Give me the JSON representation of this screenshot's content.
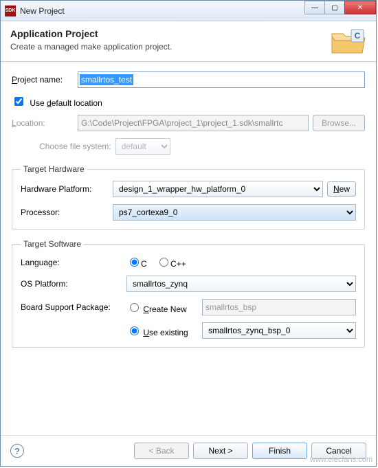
{
  "window": {
    "title": "New Project"
  },
  "header": {
    "title": "Application Project",
    "subtitle": "Create a managed make application project."
  },
  "project": {
    "name_label": "Project name:",
    "name_value": "smallrtos_test"
  },
  "location": {
    "use_default_label": "Use default location",
    "use_default_checked": true,
    "location_label": "Location:",
    "location_value": "G:\\Code\\Project\\FPGA\\project_1\\project_1.sdk\\smallrtc",
    "browse_label": "Browse...",
    "filesystem_label": "Choose file system:",
    "filesystem_value": "default"
  },
  "hardware": {
    "group_title": "Target Hardware",
    "platform_label": "Hardware Platform:",
    "platform_value": "design_1_wrapper_hw_platform_0",
    "new_label": "New",
    "processor_label": "Processor:",
    "processor_value": "ps7_cortexa9_0"
  },
  "software": {
    "group_title": "Target Software",
    "language_label": "Language:",
    "lang_c": "C",
    "lang_cpp": "C++",
    "os_label": "OS Platform:",
    "os_value": "smallrtos_zynq",
    "bsp_label": "Board Support Package:",
    "bsp_create_label": "Create New",
    "bsp_create_value": "smallrtos_bsp",
    "bsp_existing_label": "Use existing",
    "bsp_existing_value": "smallrtos_zynq_bsp_0"
  },
  "footer": {
    "back": "< Back",
    "next": "Next >",
    "finish": "Finish",
    "cancel": "Cancel"
  },
  "watermark": "www.elecfans.com"
}
